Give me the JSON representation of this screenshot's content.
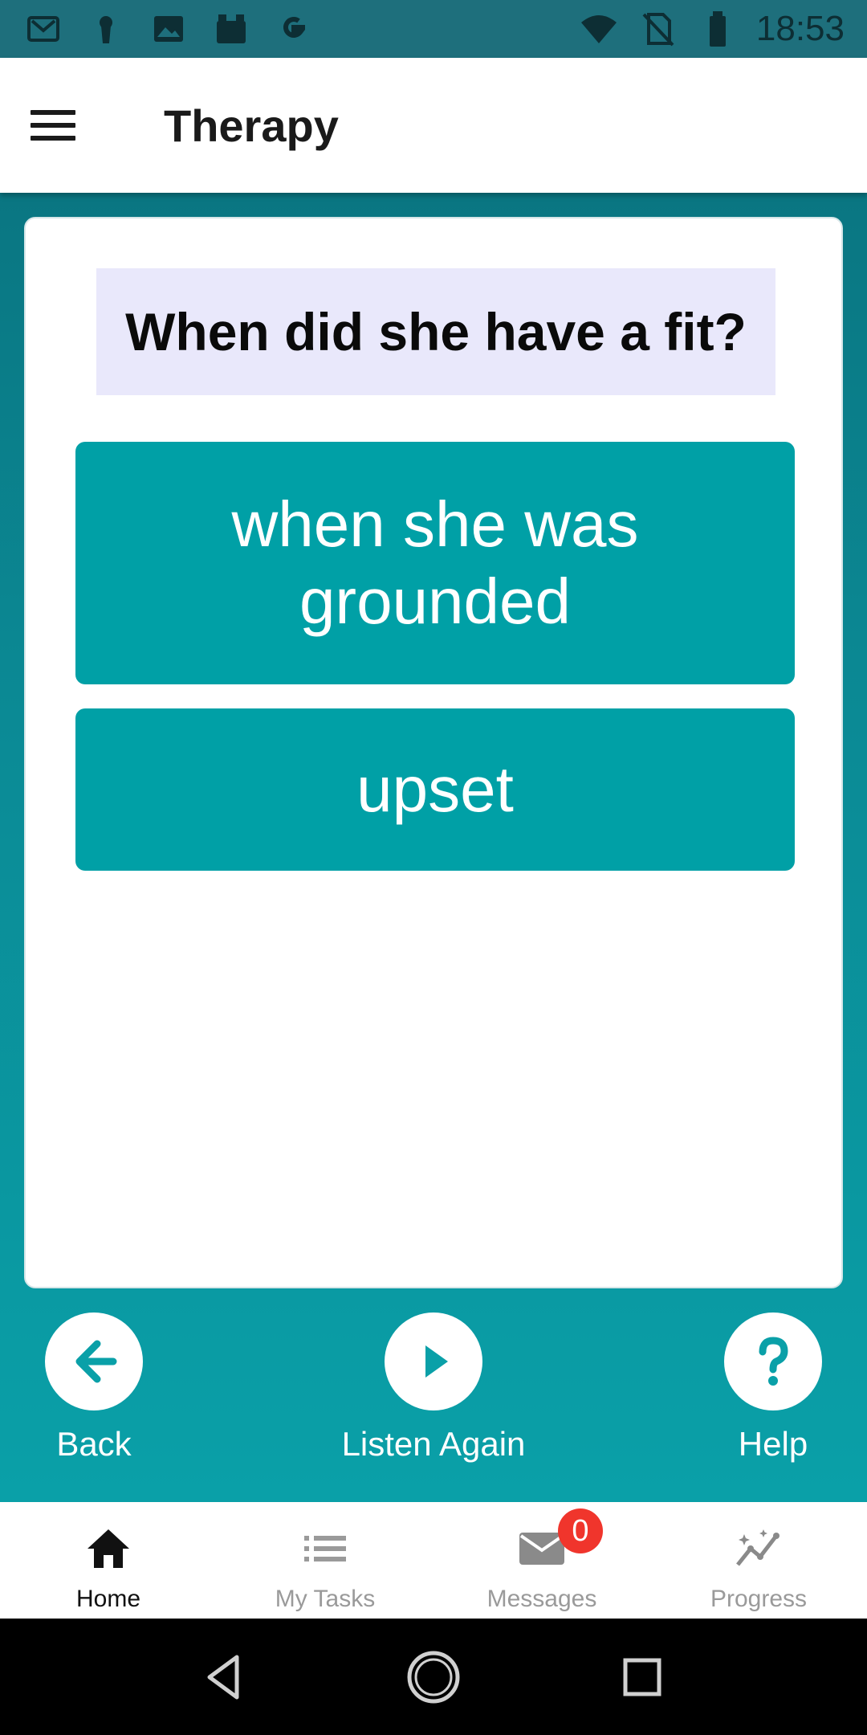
{
  "status_bar": {
    "time": "18:53",
    "left_icons": [
      "gmail-icon",
      "keyhole-icon",
      "image-icon",
      "box-icon",
      "google-g-icon"
    ],
    "right_icons": [
      "wifi-icon",
      "no-sim-icon",
      "battery-icon"
    ]
  },
  "app_bar": {
    "title": "Therapy",
    "menu_icon": "hamburger-menu-icon"
  },
  "exercise": {
    "question": "When did she have a fit?",
    "answers": [
      {
        "line1": "when she was",
        "line2": "grounded"
      },
      {
        "line1": "upset"
      }
    ]
  },
  "controls": {
    "back_label": "Back",
    "listen_label": "Listen Again",
    "help_label": "Help"
  },
  "bottom_nav": {
    "items": [
      {
        "label": "Home",
        "icon": "home-icon",
        "active": true
      },
      {
        "label": "My Tasks",
        "icon": "list-icon",
        "active": false
      },
      {
        "label": "Messages",
        "icon": "mail-icon",
        "active": false,
        "badge": "0"
      },
      {
        "label": "Progress",
        "icon": "progress-chart-icon",
        "active": false
      }
    ]
  },
  "colors": {
    "status_bar": "#1e6f7c",
    "accent_teal": "#00a0a6",
    "question_bg": "#e9e8fb",
    "badge": "#f0352c"
  }
}
